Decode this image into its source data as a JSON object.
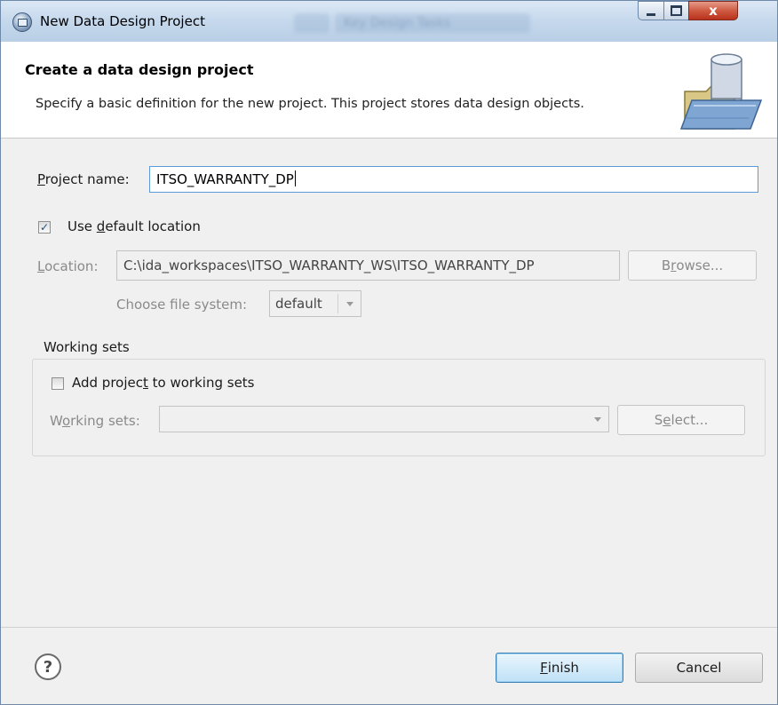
{
  "window": {
    "title": "New Data Design Project",
    "ghost_text": "Key Design Tasks",
    "close_glyph": "x"
  },
  "banner": {
    "title": "Create a data design project",
    "description": "Specify a basic definition for the new project. This project stores data design objects."
  },
  "project_name": {
    "label_pre": "",
    "label_key": "P",
    "label_post": "roject name:",
    "value": "ITSO_WARRANTY_DP"
  },
  "default_location": {
    "checked": true,
    "label_pre": "Use ",
    "label_key": "d",
    "label_post": "efault location"
  },
  "location": {
    "label_pre": "",
    "label_key": "L",
    "label_post": "ocation:",
    "value": "C:\\ida_workspaces\\ITSO_WARRANTY_WS\\ITSO_WARRANTY_DP",
    "browse_pre": "B",
    "browse_key": "r",
    "browse_post": "owse..."
  },
  "file_system": {
    "label": "Choose file system:",
    "value": "default"
  },
  "working_sets_group": {
    "title": "Working sets",
    "add_checked": false,
    "add_pre": "Add projec",
    "add_key": "t",
    "add_post": " to working sets",
    "sets_pre": "W",
    "sets_key": "o",
    "sets_post": "rking sets:",
    "sets_value": "",
    "select_pre": "S",
    "select_key": "e",
    "select_post": "lect..."
  },
  "footer": {
    "help_glyph": "?",
    "finish_pre": "",
    "finish_key": "F",
    "finish_post": "inish",
    "cancel_label": "Cancel"
  },
  "colors": {
    "title_bar": "#c5d8ec",
    "dialog_bg": "#f0f0f0",
    "close_button": "#cf5b42",
    "default_button": "#3c7fb1"
  }
}
